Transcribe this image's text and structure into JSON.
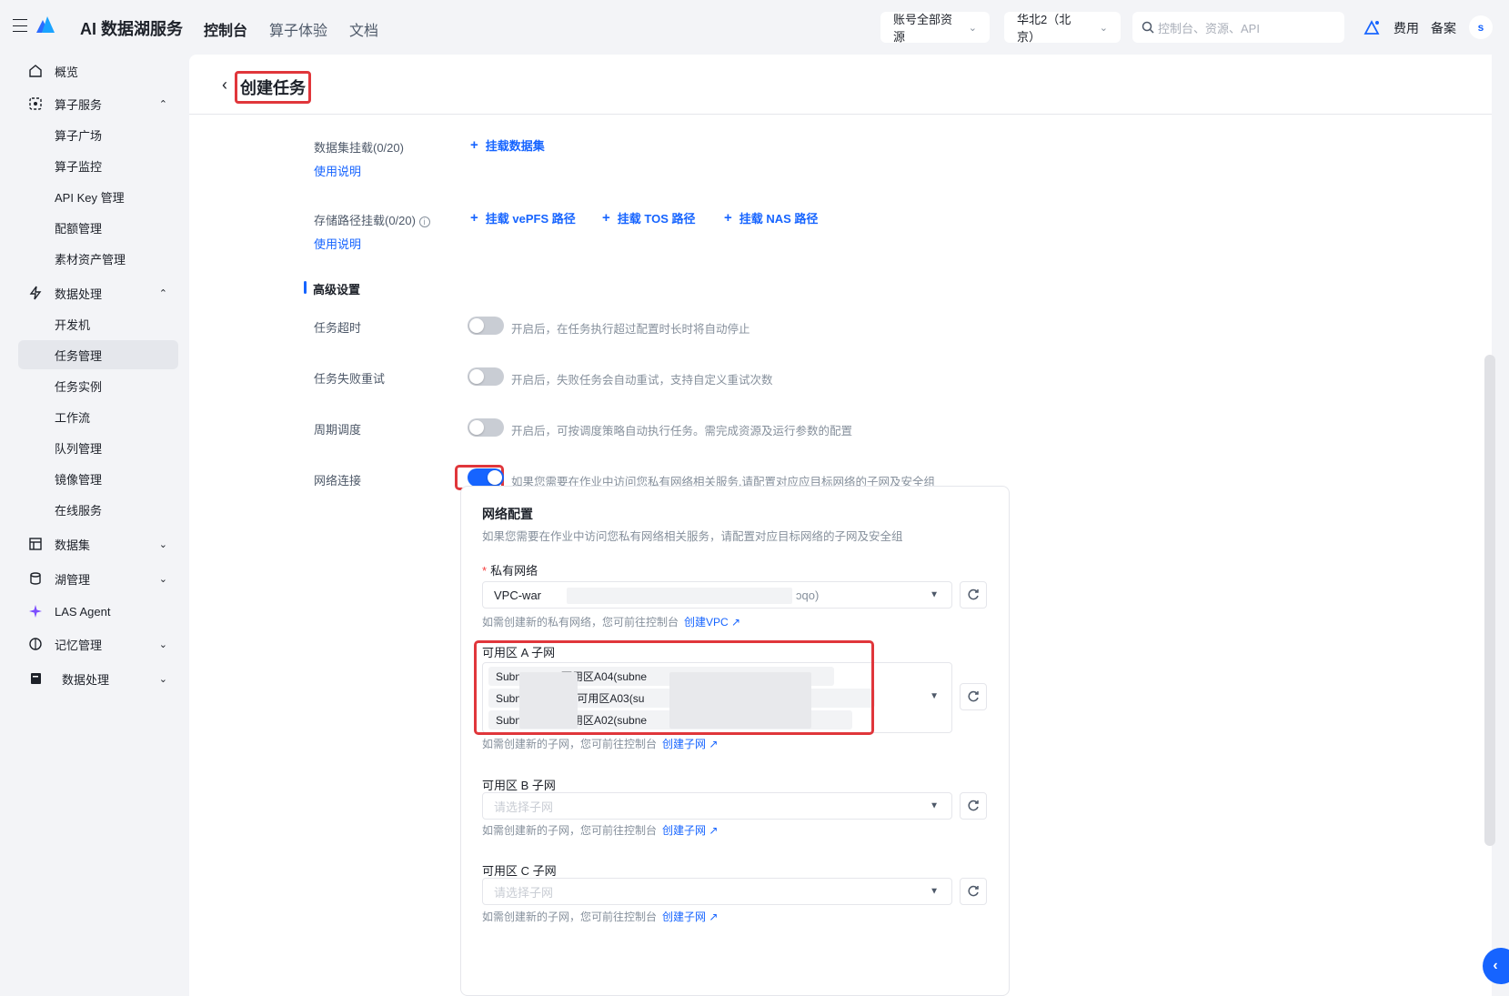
{
  "topbar": {
    "brand": "AI 数据湖服务",
    "nav": [
      "控制台",
      "算子体验",
      "文档"
    ],
    "account_scope": "账号全部资源",
    "region": "华北2（北京）",
    "search_placeholder": "控制台、资源、API",
    "fee": "费用",
    "filing": "备案",
    "avatar": "s"
  },
  "sidebar": {
    "overview": "概览",
    "operator_service": "算子服务",
    "operator_plaza": "算子广场",
    "operator_monitor": "算子监控",
    "api_key": "API Key 管理",
    "quota": "配额管理",
    "material": "素材资产管理",
    "data_processing": "数据处理",
    "dev_machine": "开发机",
    "task_management": "任务管理",
    "task_instance": "任务实例",
    "workflow": "工作流",
    "queue": "队列管理",
    "image": "镜像管理",
    "online_service": "在线服务",
    "dataset": "数据集",
    "lake": "湖管理",
    "las_agent": "LAS Agent",
    "memory": "记忆管理",
    "data_processing2": "数据处理"
  },
  "page": {
    "title": "创建任务",
    "dataset_mount_label": "数据集挂载(0/20)",
    "usage_link": "使用说明",
    "mount_dataset": "挂载数据集",
    "storage_mount_label": "存储路径挂载(0/20)",
    "mount_vepfs": "挂载 vePFS 路径",
    "mount_tos": "挂载 TOS 路径",
    "mount_nas": "挂载 NAS 路径",
    "advanced": "高级设置",
    "timeout_label": "任务超时",
    "timeout_hint": "开启后，在任务执行超过配置时长时将自动停止",
    "retry_label": "任务失败重试",
    "retry_hint": "开启后，失败任务会自动重试，支持自定义重试次数",
    "schedule_label": "周期调度",
    "schedule_hint": "开启后，可按调度策略自动执行任务。需完成资源及运行参数的配置",
    "network_label": "网络连接",
    "network_hint": "如果您需要在作业中访问您私有网络相关服务,请配置对应应目标网络的子网及安全组"
  },
  "network": {
    "title": "网络配置",
    "desc": "如果您需要在作业中访问您私有网络相关服务，请配置对应目标网络的子网及安全组",
    "vpc_label": "私有网络",
    "vpc_value_start": "VPC-war",
    "vpc_value_end": "ɔqo)",
    "vpc_hint": "如需创建新的私有网络，您可前往控制台",
    "vpc_create": "创建VPC",
    "zone_a_label": "可用区 A 子网",
    "zone_a_tags": [
      "Subn          9-可用区A04(subne                              n)",
      "Subn          3-25-可用区A03(su                              tzo4)",
      "Subn          2-可用区A02(subne                              t)"
    ],
    "subnet_hint": "如需创建新的子网，您可前往控制台",
    "subnet_create": "创建子网",
    "zone_b_label": "可用区 B 子网",
    "zone_c_label": "可用区 C 子网",
    "subnet_placeholder": "请选择子网"
  }
}
